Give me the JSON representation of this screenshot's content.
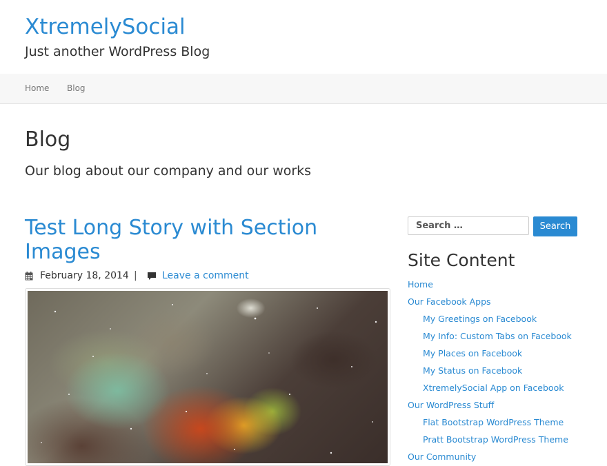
{
  "header": {
    "site_title": "XtremelySocial",
    "site_description": "Just another WordPress Blog"
  },
  "nav": {
    "items": [
      {
        "label": "Home"
      },
      {
        "label": "Blog"
      }
    ]
  },
  "page": {
    "title": "Blog",
    "subtitle": "Our blog about our company and our works"
  },
  "post": {
    "title": "Test Long Story with Section Images",
    "date": "February 18, 2014",
    "separator": "|",
    "comment_link": "Leave a comment",
    "icons": {
      "date": "calendar-icon",
      "comment": "comment-icon"
    }
  },
  "sidebar": {
    "search": {
      "placeholder": "Search …",
      "button_label": "Search"
    },
    "widget_title": "Site Content",
    "links": [
      {
        "label": "Home",
        "level": 0
      },
      {
        "label": "Our Facebook Apps",
        "level": 0
      },
      {
        "label": "My Greetings on Facebook",
        "level": 1
      },
      {
        "label": "My Info: Custom Tabs on Facebook",
        "level": 1
      },
      {
        "label": "My Places on Facebook",
        "level": 1
      },
      {
        "label": "My Status on Facebook",
        "level": 1
      },
      {
        "label": "XtremelySocial App on Facebook",
        "level": 1
      },
      {
        "label": "Our WordPress Stuff",
        "level": 0
      },
      {
        "label": "Flat Bootstrap WordPress Theme",
        "level": 1
      },
      {
        "label": "Pratt Bootstrap WordPress Theme",
        "level": 1
      },
      {
        "label": "Our Community",
        "level": 0
      }
    ]
  },
  "colors": {
    "accent": "#2a8ad2",
    "text": "#333333",
    "navbar_bg": "#f7f7f7"
  }
}
